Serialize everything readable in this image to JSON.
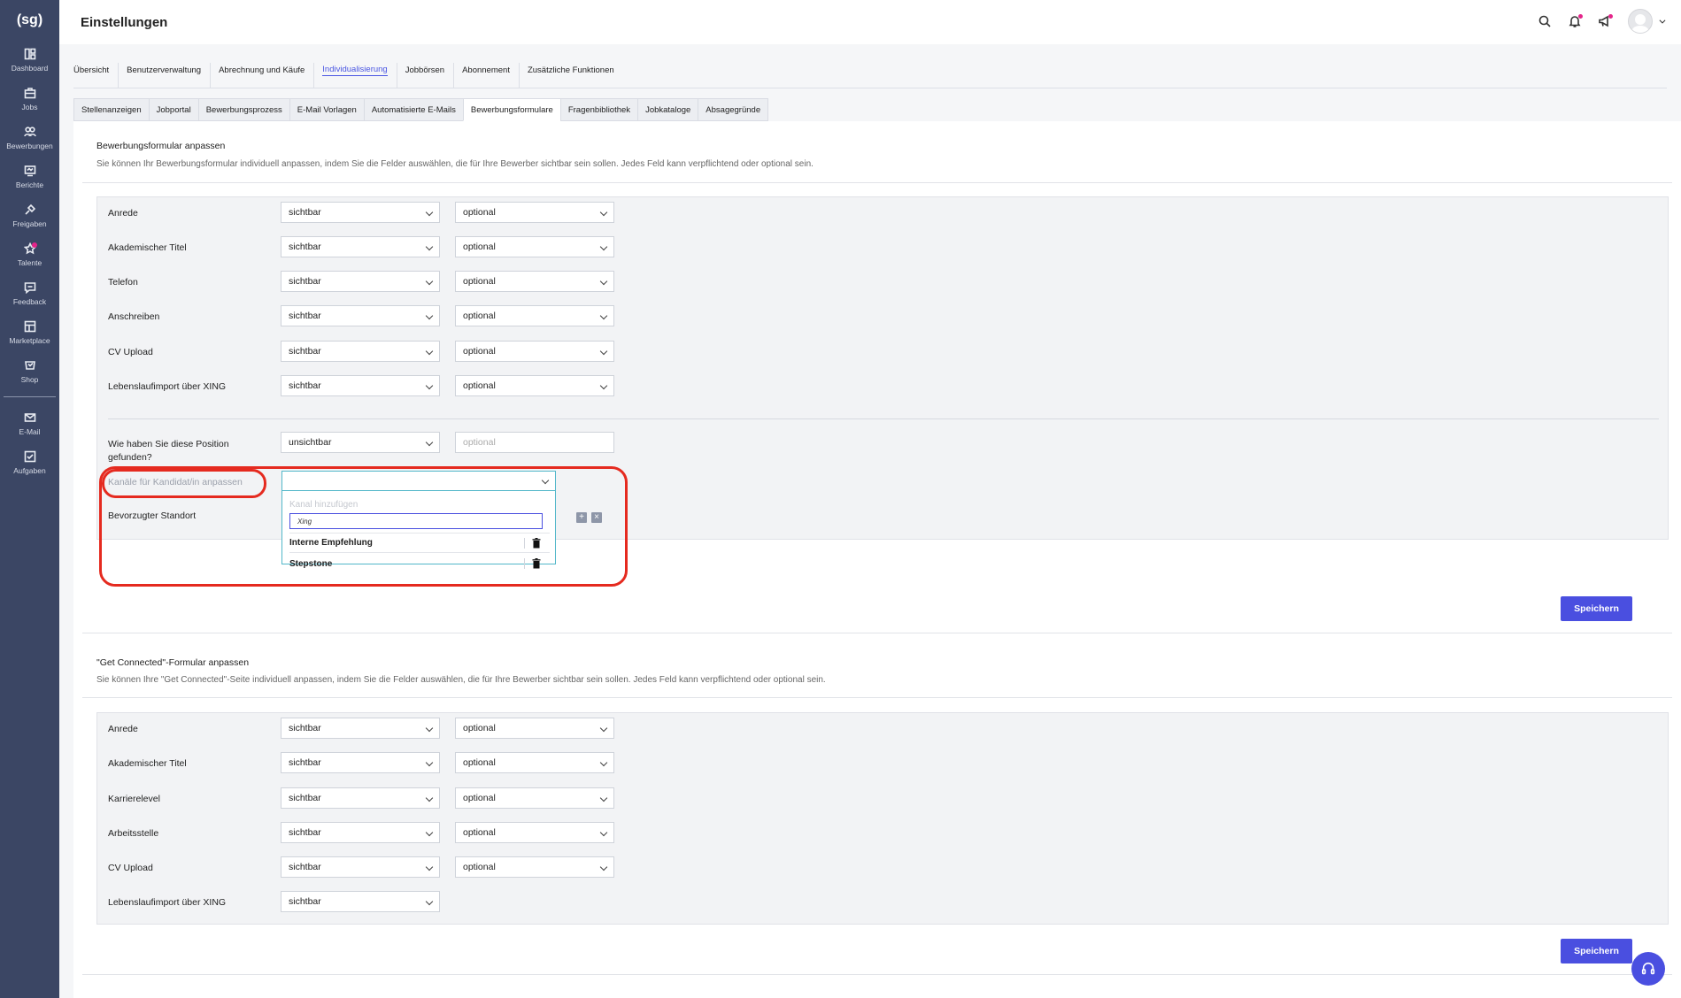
{
  "app": {
    "logo": "(sg)",
    "page_title": "Einstellungen"
  },
  "sidebar": {
    "items": [
      {
        "label": "Dashboard",
        "icon": "dashboard-icon"
      },
      {
        "label": "Jobs",
        "icon": "briefcase-icon"
      },
      {
        "label": "Bewerbungen",
        "icon": "users-icon"
      },
      {
        "label": "Berichte",
        "icon": "report-icon"
      },
      {
        "label": "Freigaben",
        "icon": "approval-icon"
      },
      {
        "label": "Talente",
        "icon": "star-icon"
      },
      {
        "label": "Feedback",
        "icon": "feedback-icon"
      },
      {
        "label": "Marketplace",
        "icon": "marketplace-icon"
      },
      {
        "label": "Shop",
        "icon": "shop-icon"
      }
    ],
    "bottom_items": [
      {
        "label": "E-Mail",
        "icon": "mail-icon"
      },
      {
        "label": "Aufgaben",
        "icon": "tasks-icon"
      }
    ]
  },
  "top_tabs": [
    "Übersicht",
    "Benutzerverwaltung",
    "Abrechnung und Käufe",
    "Individualisierung",
    "Jobbörsen",
    "Abonnement",
    "Zusätzliche Funktionen"
  ],
  "top_tab_active": "Individualisierung",
  "sub_tabs": [
    "Stellenanzeigen",
    "Jobportal",
    "Bewerbungsprozess",
    "E-Mail Vorlagen",
    "Automatisierte E-Mails",
    "Bewerbungsformulare",
    "Fragenbibliothek",
    "Jobkataloge",
    "Absagegründe"
  ],
  "sub_tab_active": "Bewerbungsformulare",
  "section1": {
    "title": "Bewerbungsformular anpassen",
    "description": "Sie können Ihr Bewerbungsformular individuell anpassen, indem Sie die Felder auswählen, die für Ihre Bewerber sichtbar sein sollen. Jedes Feld kann verpflichtend oder optional sein.",
    "rows": [
      {
        "label": "Anrede",
        "visibility": "sichtbar",
        "requirement": "optional"
      },
      {
        "label": "Akademischer Titel",
        "visibility": "sichtbar",
        "requirement": "optional"
      },
      {
        "label": "Telefon",
        "visibility": "sichtbar",
        "requirement": "optional"
      },
      {
        "label": "Anschreiben",
        "visibility": "sichtbar",
        "requirement": "optional"
      },
      {
        "label": "CV Upload",
        "visibility": "sichtbar",
        "requirement": "optional"
      },
      {
        "label": "Lebenslaufimport über XING",
        "visibility": "sichtbar",
        "requirement": "optional"
      }
    ],
    "position_row": {
      "label": "Wie haben Sie diese Position gefunden?",
      "visibility": "unsichtbar",
      "requirement_placeholder": "optional"
    },
    "channels_label": "Kanäle für Kandidat/in anpassen",
    "location_label": "Bevorzugter Standort",
    "save_label": "Speichern"
  },
  "channels_dropdown": {
    "add_label": "Kanal hinzufügen",
    "input_value": "Xing",
    "items": [
      "Interne Empfehlung",
      "Stepstone"
    ]
  },
  "section2": {
    "title": "\"Get Connected\"-Formular anpassen",
    "description": "Sie können Ihre \"Get Connected\"-Seite individuell anpassen, indem Sie die Felder auswählen, die für Ihre Bewerber sichtbar sein sollen. Jedes Feld kann verpflichtend oder optional sein.",
    "rows": [
      {
        "label": "Anrede",
        "visibility": "sichtbar",
        "requirement": "optional"
      },
      {
        "label": "Akademischer Titel",
        "visibility": "sichtbar",
        "requirement": "optional"
      },
      {
        "label": "Karrierelevel",
        "visibility": "sichtbar",
        "requirement": "optional"
      },
      {
        "label": "Arbeitsstelle",
        "visibility": "sichtbar",
        "requirement": "optional"
      },
      {
        "label": "CV Upload",
        "visibility": "sichtbar",
        "requirement": "optional"
      },
      {
        "label": "Lebenslaufimport über XING",
        "visibility": "sichtbar"
      }
    ],
    "save_label": "Speichern"
  },
  "colors": {
    "accent": "#4a4fe0",
    "sidebar": "#3b4664",
    "highlight": "#e52a1f",
    "badge": "#e4248a"
  }
}
